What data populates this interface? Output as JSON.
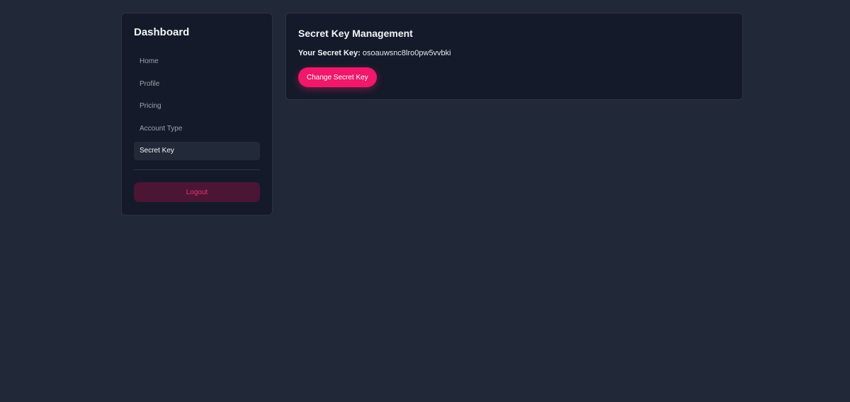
{
  "sidebar": {
    "title": "Dashboard",
    "items": [
      {
        "label": "Home",
        "active": false
      },
      {
        "label": "Profile",
        "active": false
      },
      {
        "label": "Pricing",
        "active": false
      },
      {
        "label": "Account Type",
        "active": false
      },
      {
        "label": "Secret Key",
        "active": true
      }
    ],
    "logout_label": "Logout"
  },
  "main": {
    "title": "Secret Key Management",
    "key_label": "Your Secret Key:",
    "key_value": "osoauwsnc8lro0pw5vvbki",
    "change_button_label": "Change Secret Key"
  },
  "colors": {
    "background": "#212938",
    "panel": "#141a29",
    "accent": "#f0186a",
    "logout_bg": "#4a1634"
  }
}
